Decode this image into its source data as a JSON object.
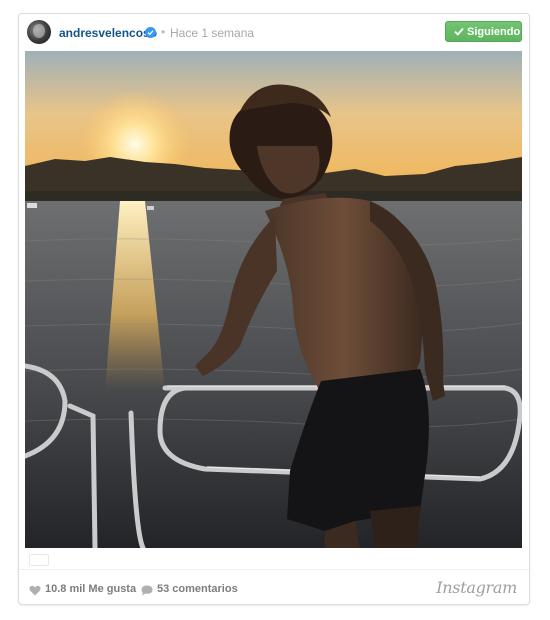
{
  "post": {
    "username": "andresvelencoso",
    "separator": "•",
    "timestamp": "Hace 1 semana",
    "follow_label": "Siguiendo",
    "likes": "10.8 mil Me gusta",
    "comments": "53 comentarios",
    "brand": "Instagram"
  },
  "icons": {
    "avatar": "profile-photo",
    "verified": "verified-badge-icon",
    "check": "check-icon",
    "heart": "heart-icon",
    "comment": "comment-bubble-icon"
  },
  "colors": {
    "username": "#125688",
    "follow_button": "#6cc070",
    "verified": "#3897f0",
    "meta_text": "#7d7d7d"
  }
}
